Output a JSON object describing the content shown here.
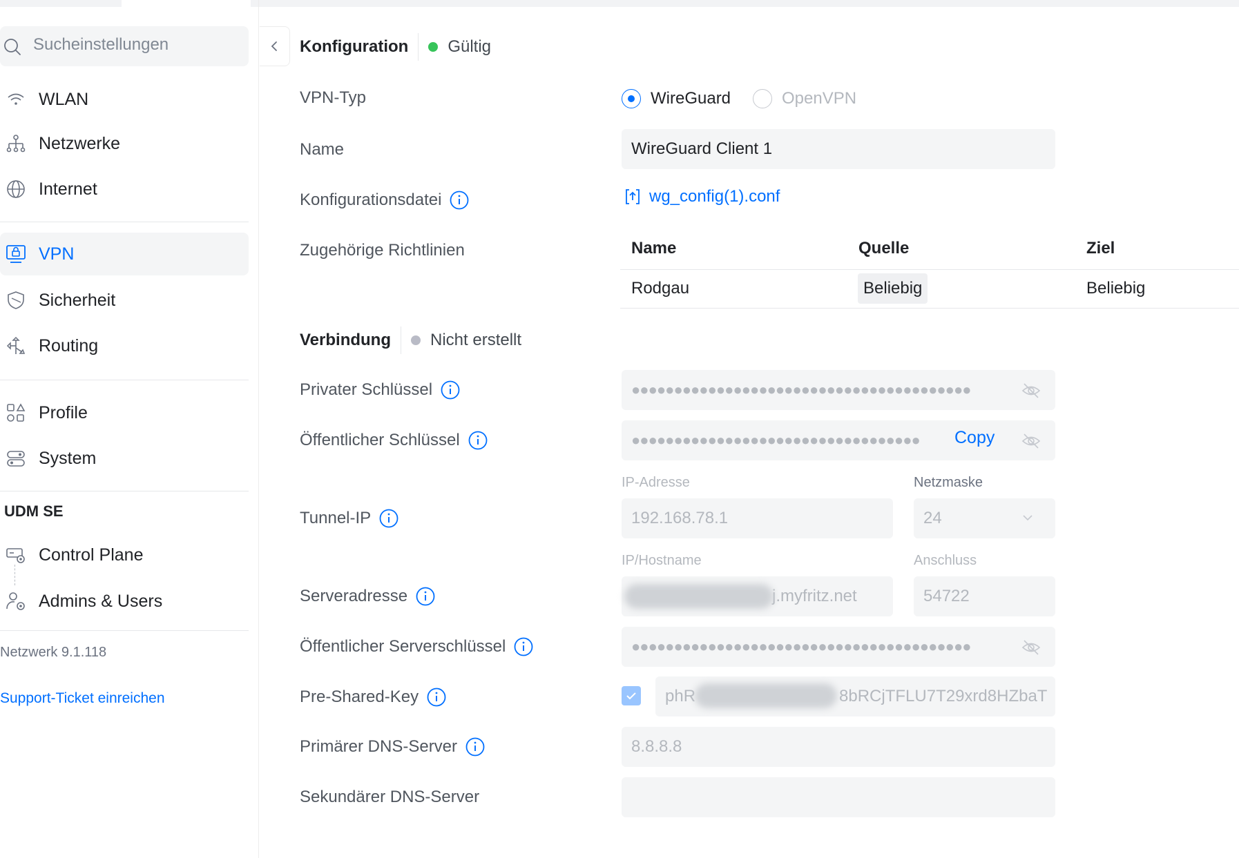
{
  "sidebar": {
    "search_placeholder": "Sucheinstellungen",
    "items": [
      {
        "label": "WLAN",
        "icon": "wifi-icon"
      },
      {
        "label": "Netzwerke",
        "icon": "network-topology-icon"
      },
      {
        "label": "Internet",
        "icon": "globe-icon"
      },
      {
        "label": "VPN",
        "icon": "vpn-lock-icon",
        "active": true
      },
      {
        "label": "Sicherheit",
        "icon": "shield-icon"
      },
      {
        "label": "Routing",
        "icon": "routing-icon"
      },
      {
        "label": "Profile",
        "icon": "profiles-icon"
      },
      {
        "label": "System",
        "icon": "system-icon"
      }
    ],
    "device_section": "UDM SE",
    "device_items": [
      {
        "label": "Control Plane",
        "icon": "control-plane-icon"
      },
      {
        "label": "Admins & Users",
        "icon": "admins-users-icon"
      }
    ],
    "version": "Netzwerk 9.1.118",
    "support_link": "Support-Ticket einreichen"
  },
  "config": {
    "title": "Konfiguration",
    "status": "Gültig",
    "status_color": "#37c45a",
    "vpn_type_label": "VPN-Typ",
    "vpn_types": [
      "WireGuard",
      "OpenVPN"
    ],
    "vpn_type_selected": "WireGuard",
    "name_label": "Name",
    "name_value": "WireGuard Client 1",
    "config_file_label": "Konfigurationsdatei",
    "config_file_name": "wg_config(1).conf",
    "policies_label": "Zugehörige Richtlinien",
    "policies_columns": [
      "Name",
      "Quelle",
      "Ziel"
    ],
    "policies_rows": [
      {
        "name": "Rodgau",
        "source": "Beliebig",
        "target": "Beliebig"
      }
    ]
  },
  "connection": {
    "title": "Verbindung",
    "status": "Nicht erstellt",
    "status_color": "#b9bbc6",
    "private_key_label": "Privater Schlüssel",
    "private_key_masked": "●●●●●●●●●●●●●●●●●●●●●●●●●●●●●●●●●●●●●●●●",
    "public_key_label": "Öffentlicher Schlüssel",
    "public_key_masked": "●●●●●●●●●●●●●●●●●●●●●●●●●●●●●●●●●●",
    "copy_label": "Copy",
    "tunnel_ip_label": "Tunnel-IP",
    "ip_address_label": "IP-Adresse",
    "ip_address_value": "192.168.78.1",
    "netmask_label": "Netzmaske",
    "netmask_value": "24",
    "server_address_label": "Serveradresse",
    "hostname_label": "IP/Hostname",
    "hostname_value": "j.myfritz.net",
    "port_label": "Anschluss",
    "port_value": "54722",
    "server_public_key_label": "Öffentlicher Serverschlüssel",
    "server_public_key_masked": "●●●●●●●●●●●●●●●●●●●●●●●●●●●●●●●●●●●●●●●●",
    "psk_label": "Pre-Shared-Key",
    "psk_value_prefix": "phR",
    "psk_value_suffix": "8bRCjTFLU7T29xrd8HZbaT",
    "primary_dns_label": "Primärer DNS-Server",
    "primary_dns_value": "8.8.8.8",
    "secondary_dns_label": "Sekundärer DNS-Server",
    "secondary_dns_value": ""
  },
  "colors": {
    "accent": "#006fff",
    "field_bg": "#f4f5f6"
  }
}
